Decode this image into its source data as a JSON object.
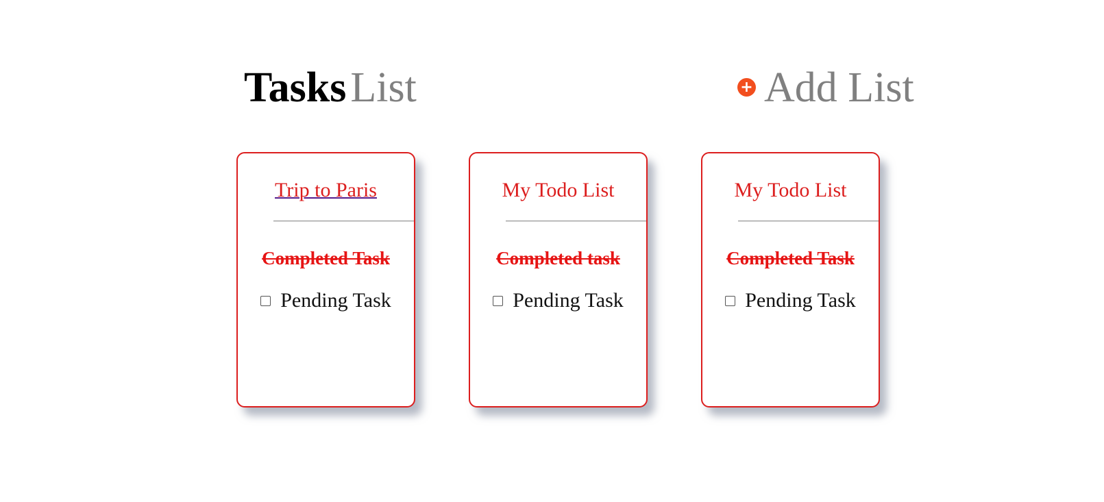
{
  "header": {
    "title_strong": "Tasks",
    "title_light": "List",
    "add_list_label": "Add List",
    "add_icon_glyph": "+"
  },
  "colors": {
    "accent_red": "#dc1e1e",
    "add_icon_bg": "#f24e1e",
    "muted_text": "#808080"
  },
  "lists": [
    {
      "title": "Trip to Paris",
      "completed": "Completed Task",
      "pending": "Pending Task",
      "pending_checked": false
    },
    {
      "title": "My Todo List",
      "completed": "Completed task",
      "pending": "Pending Task",
      "pending_checked": false
    },
    {
      "title": "My Todo List",
      "completed": "Completed Task",
      "pending": "Pending Task",
      "pending_checked": false
    }
  ]
}
